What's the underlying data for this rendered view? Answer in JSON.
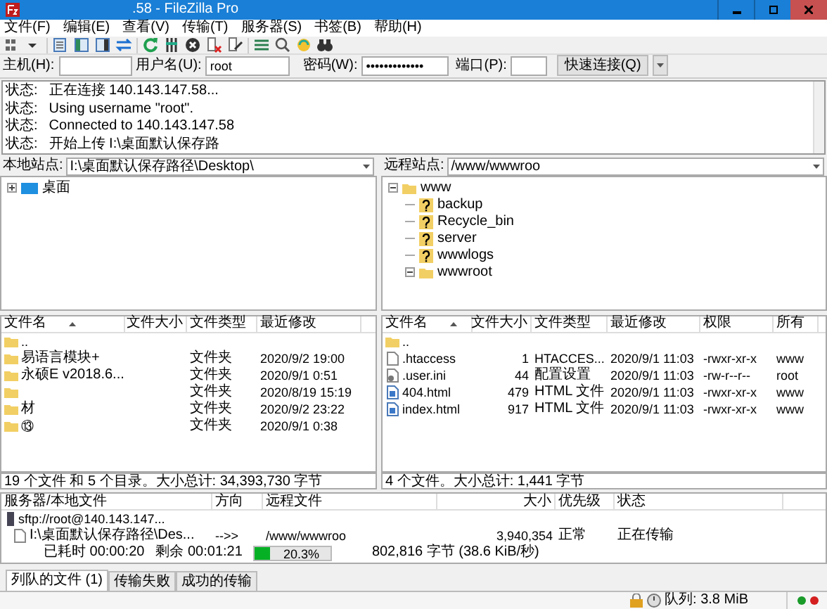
{
  "window": {
    "title": ".58 - FileZilla Pro"
  },
  "menu": [
    "文件(F)",
    "编辑(E)",
    "查看(V)",
    "传输(T)",
    "服务器(S)",
    "书签(B)",
    "帮助(H)"
  ],
  "quickconnect": {
    "host_label": "主机(H):",
    "user_label": "用户名(U):",
    "user": "root",
    "password_label": "密码(W):",
    "password": "•••••••••••••",
    "port_label": "端口(P):",
    "button": "快速连接(Q)"
  },
  "log": [
    {
      "label": "状态:",
      "message": "正在连接 140.143.147.58..."
    },
    {
      "label": "状态:",
      "message": "Using username \"root\"."
    },
    {
      "label": "状态:",
      "message": "Connected to 140.143.147.58"
    },
    {
      "label": "状态:",
      "message": "开始上传 I:\\桌面默认保存路"
    }
  ],
  "local": {
    "site_label": "本地站点:",
    "path": "I:\\桌面默认保存路径\\Desktop\\",
    "tree": [
      {
        "name": "桌面",
        "kind": "desktop",
        "expanded": false
      }
    ],
    "columns": [
      "文件名",
      "文件大小",
      "文件类型",
      "最近修改"
    ],
    "rows": [
      {
        "kind": "folder",
        "name": ".."
      },
      {
        "kind": "folder",
        "name": "易语言模块+",
        "type": "文件夹",
        "modified": "2020/9/2 19:00"
      },
      {
        "kind": "folder",
        "name": "永硕E v2018.6...",
        "type": "文件夹",
        "modified": "2020/9/1 0:51"
      },
      {
        "kind": "folder",
        "type": "文件夹",
        "modified": "2020/8/19 15:19"
      },
      {
        "kind": "folder",
        "name": "材",
        "type": "文件夹",
        "modified": "2020/9/2 23:22"
      },
      {
        "kind": "folder",
        "name": "⑬",
        "type": "文件夹",
        "modified": "2020/9/1 0:38"
      }
    ],
    "status": "19 个文件 和 5 个目录。大小总计: 34,393,730 字节"
  },
  "remote": {
    "site_label": "远程站点:",
    "path": "/www/wwwroo",
    "tree": [
      {
        "name": "www",
        "kind": "folder",
        "expanded": true,
        "children": [
          {
            "name": "backup",
            "kind": "unknown"
          },
          {
            "name": "Recycle_bin",
            "kind": "unknown"
          },
          {
            "name": "server",
            "kind": "unknown"
          },
          {
            "name": "wwwlogs",
            "kind": "unknown"
          },
          {
            "name": "wwwroot",
            "kind": "folder",
            "expanded": true
          }
        ]
      }
    ],
    "columns": [
      "文件名",
      "文件大小",
      "文件类型",
      "最近修改",
      "权限",
      "所有"
    ],
    "rows": [
      {
        "kind": "folder",
        "name": ".."
      },
      {
        "kind": "file",
        "name": ".htaccess",
        "size": "1",
        "type": "HTACCES...",
        "modified": "2020/9/1 11:03",
        "permissions": "-rwxr-xr-x",
        "owner": "www"
      },
      {
        "kind": "config",
        "name": ".user.ini",
        "size": "44",
        "type": "配置设置",
        "modified": "2020/9/1 11:03",
        "permissions": "-rw-r--r--",
        "owner": "root"
      },
      {
        "kind": "html",
        "name": "404.html",
        "size": "479",
        "type": "HTML 文件",
        "modified": "2020/9/1 11:03",
        "permissions": "-rwxr-xr-x",
        "owner": "www"
      },
      {
        "kind": "html",
        "name": "index.html",
        "size": "917",
        "type": "HTML 文件",
        "modified": "2020/9/1 11:03",
        "permissions": "-rwxr-xr-x",
        "owner": "www"
      }
    ],
    "status": "4 个文件。大小总计: 1,441 字节"
  },
  "queue": {
    "columns": [
      "服务器/本地文件",
      "方向",
      "远程文件",
      "大小",
      "优先级",
      "状态"
    ],
    "server": "sftp://root@140.143.147...",
    "file": {
      "local": "I:\\桌面默认保存路径\\Des...",
      "direction": "-->>",
      "remote": "/www/wwwroo",
      "size": "3,940,354",
      "priority": "正常",
      "status": "正在传输"
    },
    "progress": {
      "elapsed": "已耗时 00:00:20",
      "remaining": "剩余 00:01:21",
      "level": 0.203,
      "percent": "20.3%",
      "transferred": "802,816 字节 (38.6 KiB/秒)"
    }
  },
  "tabs": [
    {
      "label": "列队的文件 (1)",
      "selected": true
    },
    {
      "label": "传输失败",
      "selected": false
    },
    {
      "label": "成功的传输",
      "selected": false
    }
  ],
  "status_bar": {
    "queue": "队列: 3.8 MiB"
  }
}
